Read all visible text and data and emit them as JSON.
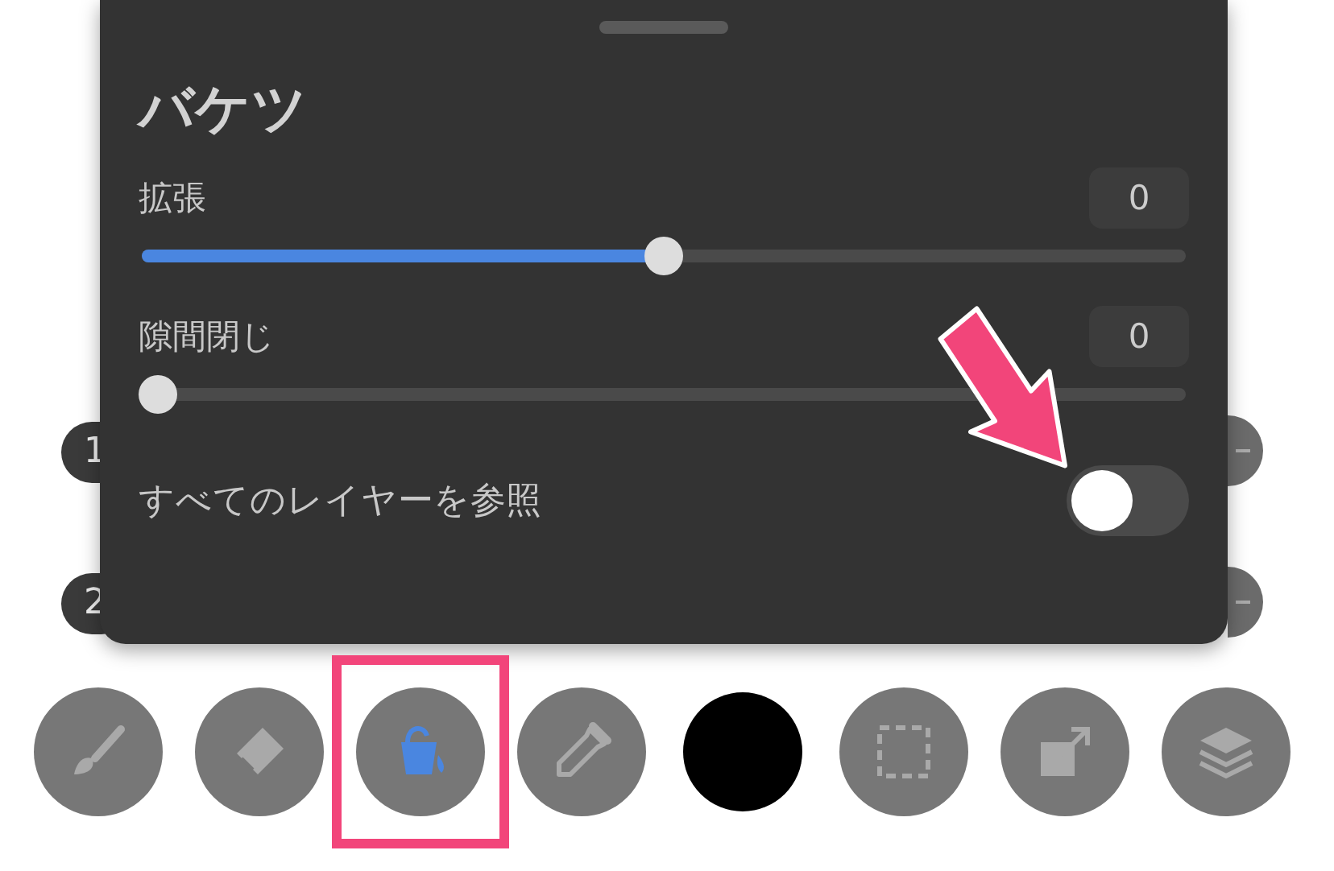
{
  "background": {
    "badges": [
      "1",
      "2"
    ]
  },
  "panel": {
    "title": "バケツ",
    "sliders": [
      {
        "label": "拡張",
        "value": "0",
        "level": 0.5
      },
      {
        "label": "隙間閉じ",
        "value": "0",
        "level": 0
      }
    ],
    "toggle": {
      "label": "すべてのレイヤーを参照",
      "on": false
    }
  },
  "toolbar": {
    "tools": [
      {
        "kind": "brush",
        "selected": false
      },
      {
        "kind": "eraser",
        "selected": false
      },
      {
        "kind": "bucket",
        "selected": true
      },
      {
        "kind": "eyedropper",
        "selected": false
      },
      {
        "kind": "color",
        "selected": false,
        "color": "#000000"
      },
      {
        "kind": "selection",
        "selected": false
      },
      {
        "kind": "transform",
        "selected": false
      },
      {
        "kind": "layers",
        "selected": false
      }
    ]
  }
}
